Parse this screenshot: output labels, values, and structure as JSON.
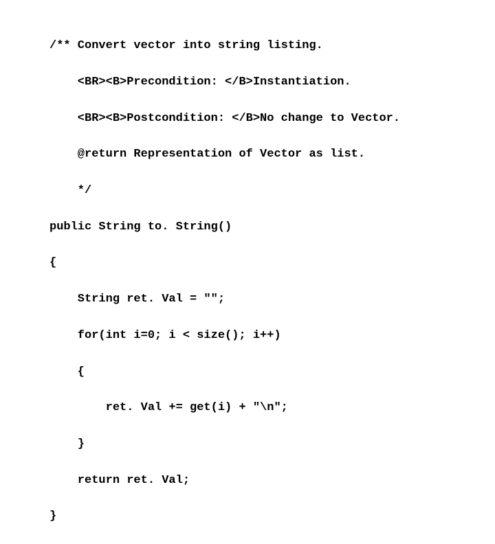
{
  "code": {
    "lines": [
      "/** Convert vector into string listing.",
      "    <BR><B>Precondition: </B>Instantiation.",
      "    <BR><B>Postcondition: </B>No change to Vector.",
      "    @return Representation of Vector as list.",
      "    */",
      "public String to. String()",
      "{",
      "    String ret. Val = \"\";",
      "    for(int i=0; i < size(); i++)",
      "    {",
      "        ret. Val += get(i) + \"\\n\";",
      "    }",
      "    return ret. Val;",
      "}"
    ]
  }
}
